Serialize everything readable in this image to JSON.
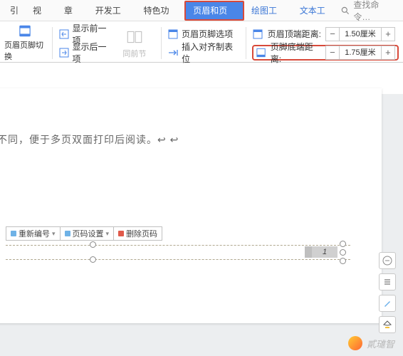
{
  "tabs": {
    "t0": "引",
    "t1": "视图",
    "t2": "章节",
    "t3": "开发工具",
    "t4": "特色功能",
    "t5": "页眉和页脚",
    "t6": "绘图工具",
    "t7": "文本工具"
  },
  "search": {
    "placeholder": "查找命令…"
  },
  "ribbon": {
    "switch": "页眉页脚切换",
    "show_prev": "显示前一项",
    "show_next": "显示后一项",
    "same_prev": "同前节",
    "options": "页眉页脚选项",
    "tabstop": "插入对齐制表位",
    "header_dist_label": "页眉顶端距离:",
    "footer_dist_label": "页脚底端距离:",
    "header_dist_val": "1.50厘米",
    "footer_dist_val": "1.75厘米"
  },
  "doc_text": "不同，便于多页双面打印后阅读。↩ ↩",
  "page_toolbar": {
    "renumber": "重新编号",
    "settings": "页码设置",
    "delete": "删除页码"
  },
  "page_num": "1",
  "watermark": "貳璡智"
}
